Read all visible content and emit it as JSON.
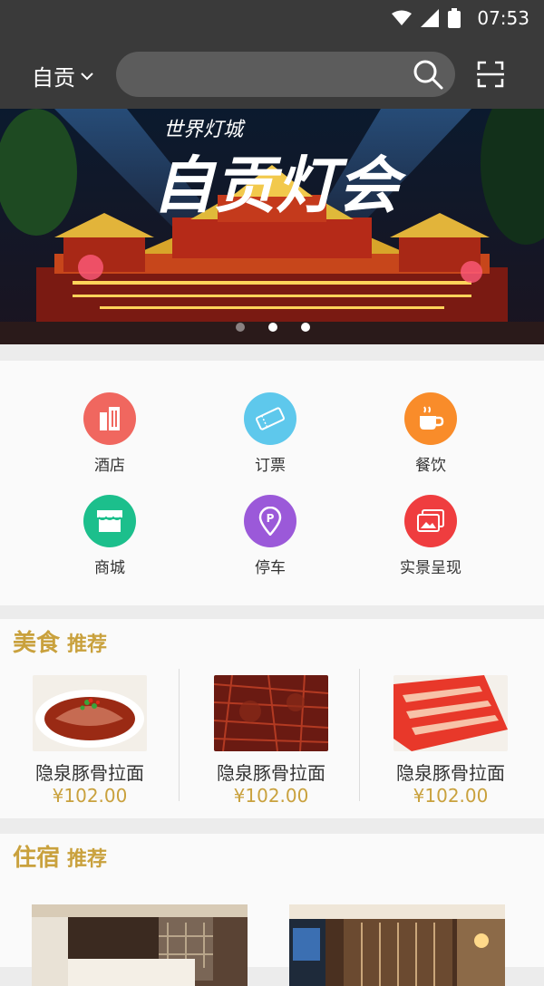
{
  "status_bar": {
    "time": "07:53"
  },
  "header": {
    "city": "自贡",
    "search": {
      "placeholder": "",
      "value": ""
    }
  },
  "banner": {
    "title_small": "世界灯城",
    "title_big": "自贡灯会",
    "active_slide": 2,
    "slide_count": 3
  },
  "categories": [
    {
      "label": "酒店",
      "icon": "building-icon",
      "color": "#f0675f"
    },
    {
      "label": "订票",
      "icon": "ticket-icon",
      "color": "#5ec8ec"
    },
    {
      "label": "餐饮",
      "icon": "coffee-cup-icon",
      "color": "#f98c2a"
    },
    {
      "label": "商城",
      "icon": "shop-icon",
      "color": "#1cbf8c"
    },
    {
      "label": "停车",
      "icon": "parking-pin-icon",
      "color": "#9b59d9"
    },
    {
      "label": "实景呈现",
      "icon": "photo-gallery-icon",
      "color": "#ef3d3f"
    }
  ],
  "food_section": {
    "title_big": "美食",
    "title_small": "推荐",
    "items": [
      {
        "name": "隐泉豚骨拉面",
        "price": "¥102.00"
      },
      {
        "name": "隐泉豚骨拉面",
        "price": "¥102.00"
      },
      {
        "name": "隐泉豚骨拉面",
        "price": "¥102.00"
      }
    ]
  },
  "hotel_section": {
    "title_big": "住宿",
    "title_small": "推荐"
  },
  "colors": {
    "accent": "#c9a13d",
    "header_bg": "#3a3a3a"
  }
}
